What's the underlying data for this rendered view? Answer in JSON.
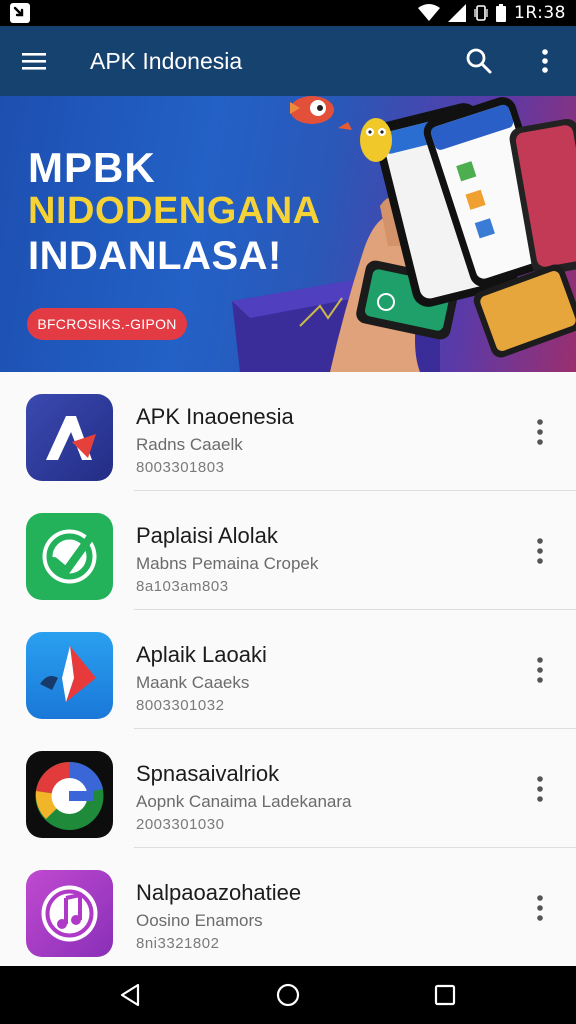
{
  "status_bar": {
    "time": "1R:38",
    "icons": [
      "app-notification-icon",
      "wifi-icon",
      "signal-icon",
      "vibrate-icon",
      "battery-icon"
    ]
  },
  "app_bar": {
    "title": "APK Indonesia",
    "icons": [
      "menu-icon",
      "search-icon",
      "overflow-menu-icon"
    ],
    "color": "#16426f"
  },
  "banner": {
    "line1": "MPBK",
    "line2": "NIDODENGANA",
    "line3": "INDANLASA!",
    "cta_label": "BFCROSIKS.-GIPON",
    "accent_yellow": "#f5d235",
    "cta_color": "#e23b44"
  },
  "apps": [
    {
      "title": "APK Inaoenesia",
      "subtitle": "Radns Caaelk",
      "meta": "8003301803",
      "icon": "arrow-a-logo-icon"
    },
    {
      "title": "Paplaisi Alolak",
      "subtitle": "Mabns Pemaina Cropek",
      "meta": "8a103am803",
      "icon": "green-check-logo-icon"
    },
    {
      "title": "Aplaik Laoaki",
      "subtitle": "Maank Caaeks",
      "meta": "8003301032",
      "icon": "red-arrow-logo-icon"
    },
    {
      "title": "Spnasaivalriok",
      "subtitle": "Aopnk Canaima Ladekanara",
      "meta": "2003301030",
      "icon": "google-g-logo-icon"
    },
    {
      "title": "Nalpaoazohatiee",
      "subtitle": "Oosino Enamors",
      "meta": "8ni3321802",
      "icon": "music-note-logo-icon"
    }
  ],
  "nav_bar": {
    "buttons": [
      "back-icon",
      "home-icon",
      "recents-icon"
    ]
  }
}
